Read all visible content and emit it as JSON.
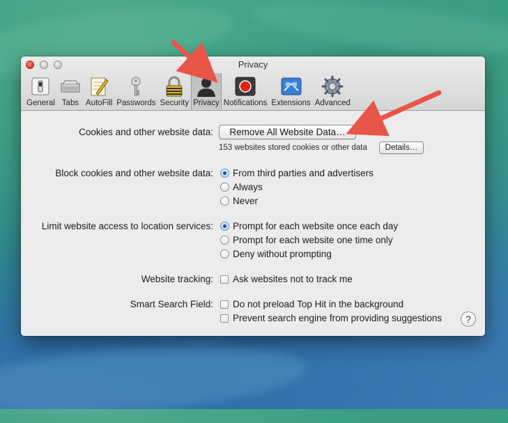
{
  "window": {
    "title": "Privacy"
  },
  "toolbar": {
    "items": [
      {
        "label": "General",
        "icon": "general-switch-icon"
      },
      {
        "label": "Tabs",
        "icon": "tabs-icon"
      },
      {
        "label": "AutoFill",
        "icon": "autofill-pencil-icon"
      },
      {
        "label": "Passwords",
        "icon": "key-icon"
      },
      {
        "label": "Security",
        "icon": "padlock-icon"
      },
      {
        "label": "Privacy",
        "icon": "person-silhouette-icon",
        "active": true
      },
      {
        "label": "Notifications",
        "icon": "notification-record-icon"
      },
      {
        "label": "Extensions",
        "icon": "extensions-puzzle-icon"
      },
      {
        "label": "Advanced",
        "icon": "gear-icon"
      }
    ]
  },
  "cookies": {
    "label": "Cookies and other website data:",
    "remove_button": "Remove All Website Data…",
    "stored_text": "153 websites stored cookies or other data",
    "details_button": "Details…"
  },
  "block_cookies": {
    "label": "Block cookies and other website data:",
    "options": [
      {
        "label": "From third parties and advertisers",
        "selected": true
      },
      {
        "label": "Always",
        "selected": false
      },
      {
        "label": "Never",
        "selected": false
      }
    ]
  },
  "location": {
    "label": "Limit website access to location services:",
    "options": [
      {
        "label": "Prompt for each website once each day",
        "selected": true
      },
      {
        "label": "Prompt for each website one time only",
        "selected": false
      },
      {
        "label": "Deny without prompting",
        "selected": false
      }
    ]
  },
  "tracking": {
    "label": "Website tracking:",
    "option": "Ask websites not to track me",
    "checked": false
  },
  "smart_search": {
    "label": "Smart Search Field:",
    "options": [
      {
        "label": "Do not preload Top Hit in the background",
        "checked": false
      },
      {
        "label": "Prevent search engine from providing suggestions",
        "checked": false
      }
    ]
  },
  "help": {
    "label": "?"
  },
  "colors": {
    "annotation_arrow": "#e8564a",
    "radio_selected": "#1d4f96"
  }
}
